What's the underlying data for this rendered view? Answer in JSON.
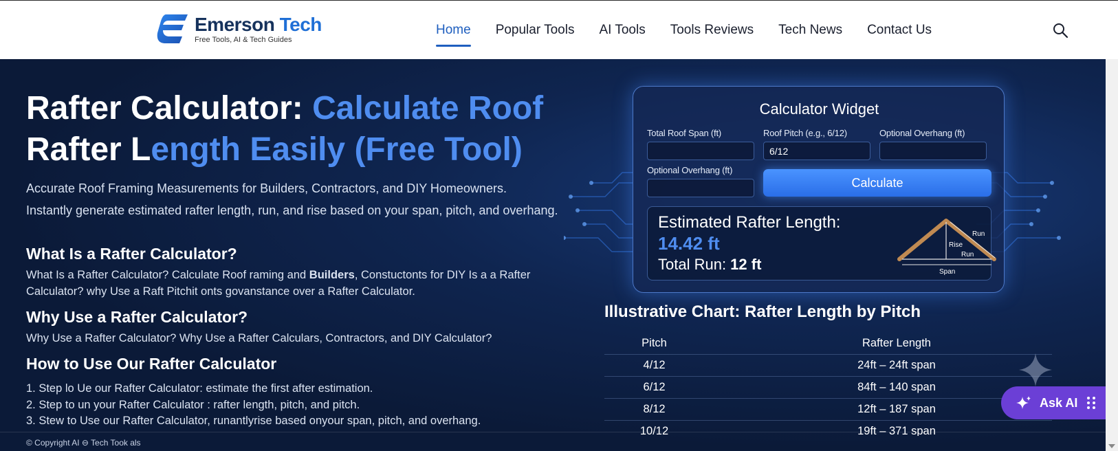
{
  "header": {
    "logo_title_main": "Emerson",
    "logo_title_accent": "Tech",
    "logo_subtitle": "Free Tools, AI & Tech Guides",
    "nav": [
      "Home",
      "Popular Tools",
      "AI Tools",
      "Tools Reviews",
      "Tech News",
      "Contact Us"
    ],
    "active_nav": "Home",
    "search_icon": "search-icon"
  },
  "hero": {
    "title_white_1": "Rafter Calculator: ",
    "title_blue_1": "Calculate Roof",
    "title_white_2": "Rafter L",
    "title_blue_2": "ength Easily (Free Tool)",
    "lead_1": "Accurate Roof Framing Measurements for Builders, Contractors, and DIY Homeowners.",
    "lead_2": "Instantly generate estimated rafter length, run, and rise based on your span, pitch, and overhang."
  },
  "sections": [
    {
      "title": "What Is a Rafter Calculator?",
      "text_1": "What Is a Rafter Calculator?  Calculate Roof raming and ",
      "text_bold": "Builders",
      "text_2": ", Constuctonts for DIY Is a a Rafter Calculator? why Use a Raft Pitchit onts govanstance over a Rafter Calculator."
    },
    {
      "title": "Why Use a Rafter Calculator?",
      "text": "Why Use a Rafter Calculator?   Why Use a Rafter Calculars, Contractors, and DIY Calculator?"
    },
    {
      "title": "How to Use Our Rafter Calculator",
      "steps": [
        "1. Step lo Ue our Rafter Calculator: estimate the first after estimation.",
        "2. Step to un your Rafter Calculator : rafter length, pitch, and   pitch.",
        "3. Stew to Use our Rafter Calculator, runantlyrise based onyour span, pitch, and overhang."
      ]
    }
  ],
  "widget": {
    "title": "Calculator Widget",
    "fields": [
      {
        "label": "Total Roof Span (ft)",
        "value": ""
      },
      {
        "label": "Roof Pitch (e.g., 6/12)",
        "value": "6/12"
      },
      {
        "label": "Optional Overhang (ft)",
        "value": ""
      },
      {
        "label": "Optional Overhang (ft)",
        "value": ""
      }
    ],
    "button": "Calculate",
    "result_label": "Estimated Rafter Length:",
    "result_value": "14.42 ft",
    "run_label": "Total Run: ",
    "run_value": "12 ft",
    "diagram_labels": {
      "run_top": "Run",
      "rise": "Rise",
      "run": "Run",
      "span": "Span"
    }
  },
  "chart": {
    "title": "Illustrative Chart: Rafter Length by Pitch",
    "headers": [
      "Pitch",
      "Rafter Length"
    ],
    "rows": [
      [
        "4/12",
        "24ft – 24ft span"
      ],
      [
        "6/12",
        "84ft  – 140 span"
      ],
      [
        "8/12",
        "12ft – 187 span"
      ],
      [
        "10/12",
        "19ft – 371 span"
      ]
    ]
  },
  "ask_ai": {
    "label": "Ask AI"
  },
  "footer": {
    "copyright": "© Copyright AI ⊖ Tech Took als"
  },
  "colors": {
    "accent_blue": "#4f8df0",
    "nav_active": "#1f5fbf",
    "ask_ai_purple": "#6b3fd6",
    "hero_bg": "#0b1a38"
  }
}
